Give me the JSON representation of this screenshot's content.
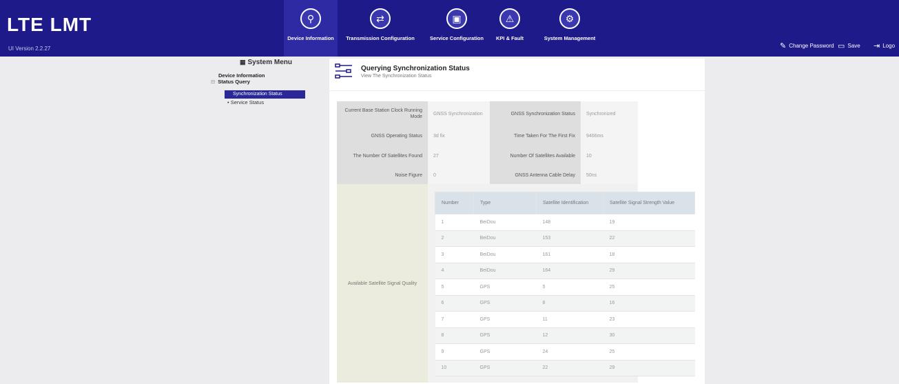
{
  "header": {
    "app_title": "LTE  LMT",
    "version": "UI Version 2.2.27",
    "nav": [
      {
        "label": "Device Information",
        "icon": "device-icon",
        "glyph": "⚲"
      },
      {
        "label": "Transmission Configuration",
        "icon": "transmission-icon",
        "glyph": "⇄"
      },
      {
        "label": "Service Configuration",
        "icon": "briefcase-icon",
        "glyph": "▣"
      },
      {
        "label": "KPI & Fault",
        "icon": "warning-icon",
        "glyph": "⚠"
      },
      {
        "label": "System Management",
        "icon": "gear-icon",
        "glyph": "⚙"
      }
    ],
    "actions": {
      "change_password": "Change Password",
      "save": "Save",
      "logout": "Logo"
    },
    "colors": {
      "bar": "#1e1a8a",
      "active": "#2d2aa3"
    }
  },
  "menu": {
    "title": "System Menu",
    "device_information": "Device Information",
    "status_query": "Status Query",
    "tree_toggle": "⊟",
    "synchronization_status": "Synchronization Status",
    "service_status": "• Service Status"
  },
  "panel": {
    "title": "Querying Synchronization Status",
    "subtitle": "View The Synchronization Status"
  },
  "info": {
    "clock_mode_label": "Current Base Station Clock Running Mode",
    "clock_mode_value": "GNSS Synchronization",
    "gnss_sync_label": "GNSS Synchronization Status",
    "gnss_sync_value": "Synchronized",
    "gnss_op_label": "GNSS Operating Status",
    "gnss_op_value": "3d fix",
    "first_fix_label": "Time Taken For The First Fix",
    "first_fix_value": "9466ms",
    "sat_found_label": "The Number Of Satellites Found",
    "sat_found_value": "27",
    "sat_avail_label": "Number Of Satellites Available",
    "sat_avail_value": "10",
    "noise_label": "Noise Figure",
    "noise_value": "0",
    "cable_delay_label": "GNSS Antenna Cable Delay",
    "cable_delay_value": "50ns",
    "signal_quality_label": "Available Satellite Signal Quality"
  },
  "satellites": {
    "headers": [
      "Number",
      "Type",
      "Satellite Identification",
      "Satellite Signal Strength Value"
    ],
    "rows": [
      [
        "1",
        "BeiDou",
        "148",
        "19"
      ],
      [
        "2",
        "BeiDou",
        "153",
        "22"
      ],
      [
        "3",
        "BeiDou",
        "161",
        "18"
      ],
      [
        "4",
        "BeiDou",
        "164",
        "29"
      ],
      [
        "5",
        "GPS",
        "5",
        "25"
      ],
      [
        "6",
        "GPS",
        "8",
        "16"
      ],
      [
        "7",
        "GPS",
        "11",
        "23"
      ],
      [
        "8",
        "GPS",
        "12",
        "30"
      ],
      [
        "9",
        "GPS",
        "24",
        "25"
      ],
      [
        "10",
        "GPS",
        "22",
        "29"
      ]
    ]
  }
}
